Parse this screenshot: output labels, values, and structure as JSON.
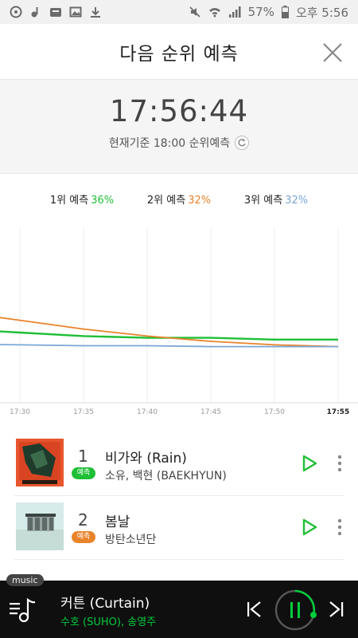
{
  "statusbar": {
    "battery": "57%",
    "time": "오후 5:56"
  },
  "header": {
    "title": "다음 순위 예측"
  },
  "timepanel": {
    "clock": "17:56:44",
    "basis": "현재기준 18:00 순위예측"
  },
  "legend": [
    {
      "label": "1위 예측",
      "pct": "36%",
      "color": "#1fbf36"
    },
    {
      "label": "2위 예측",
      "pct": "32%",
      "color": "#e8832a"
    },
    {
      "label": "3위 예측",
      "pct": "32%",
      "color": "#7aa6d6"
    }
  ],
  "chart_data": {
    "type": "line",
    "x": [
      "17:30",
      "17:35",
      "17:40",
      "17:45",
      "17:50",
      "17:55"
    ],
    "ylim": [
      0,
      100
    ],
    "grid": true,
    "series": [
      {
        "color": "#1fbf36",
        "values": [
          40,
          38,
          37,
          37,
          36,
          36
        ]
      },
      {
        "color": "#e8832a",
        "values": [
          47,
          42,
          38,
          35,
          33,
          32
        ]
      },
      {
        "color": "#7aa6d6",
        "values": [
          33,
          32.5,
          32.5,
          32,
          32,
          32
        ]
      }
    ]
  },
  "list": [
    {
      "rank": "1",
      "badge": "예측",
      "badge_color": "#1fbf36",
      "song": "비가와 (Rain)",
      "artist": "소유, 백현 (BAEKHYUN)"
    },
    {
      "rank": "2",
      "badge": "예측",
      "badge_color": "#e8832a",
      "song": "봄날",
      "artist": "방탄소년단"
    }
  ],
  "player": {
    "tag": "music",
    "title": "커튼 (Curtain)",
    "artist": "수호 (SUHO), 송영주"
  }
}
